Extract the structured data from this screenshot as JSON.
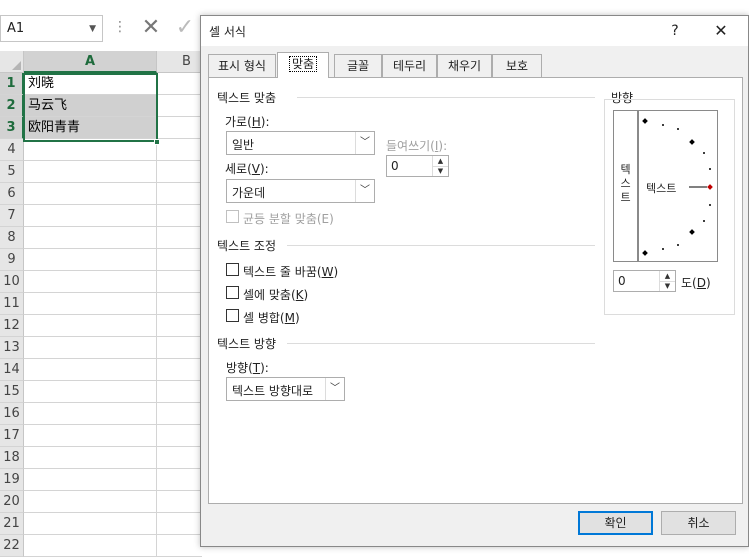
{
  "formula_bar": {
    "name_box": "A1",
    "dots": "⋮",
    "cancel_glyph": "✕",
    "confirm_glyph": "✓"
  },
  "sheet": {
    "columns": [
      "A",
      "B"
    ],
    "rows": [
      "1",
      "2",
      "3",
      "4",
      "5",
      "6",
      "7",
      "8",
      "9",
      "10",
      "11",
      "12",
      "13",
      "14",
      "15",
      "16",
      "17",
      "18",
      "19",
      "20",
      "21",
      "22"
    ],
    "cells": [
      "刘晓",
      "马云飞",
      "欧阳青青"
    ]
  },
  "dialog": {
    "title": "셀 서식",
    "help_label": "?",
    "close_label": "✕",
    "tabs": [
      "표시 형식",
      "맞춤",
      "글꼴",
      "테두리",
      "채우기",
      "보호"
    ],
    "active_tab": "맞춤",
    "text_alignment": {
      "heading": "텍스트 맞춤",
      "horizontal_label": "가로(",
      "horizontal_key": "H",
      "horizontal_label_end": "):",
      "horizontal_value": "일반",
      "indent_label": "들여쓰기(",
      "indent_key": "I",
      "indent_label_end": "):",
      "indent_value": "0",
      "vertical_label": "세로(",
      "vertical_key": "V",
      "vertical_label_end": "):",
      "vertical_value": "가운데",
      "distributed_label": "균등 분할 맞춤(E)"
    },
    "text_control": {
      "heading": "텍스트 조정",
      "wrap_label": "텍스트 줄 바꿈(",
      "wrap_key": "W",
      "wrap_end": ")",
      "shrink_label": "셀에 맞춤(",
      "shrink_key": "K",
      "shrink_end": ")",
      "merge_label": "셀 병합(",
      "merge_key": "M",
      "merge_end": ")"
    },
    "text_direction": {
      "heading": "텍스트 방향",
      "direction_label": "방향(",
      "direction_key": "T",
      "direction_label_end": "):",
      "direction_value": "텍스트 방향대로"
    },
    "orientation": {
      "heading": "방향",
      "vertical_text": "텍\n스\n트",
      "dial_text": "텍스트",
      "degrees_value": "0",
      "degrees_label": "도(",
      "degrees_key": "D",
      "degrees_label_end": ")"
    },
    "ok_label": "확인",
    "cancel_label": "취소"
  },
  "colors": {
    "excel_green": "#217346",
    "dial_point": "#c00000",
    "focus_blue": "#0078d7"
  }
}
